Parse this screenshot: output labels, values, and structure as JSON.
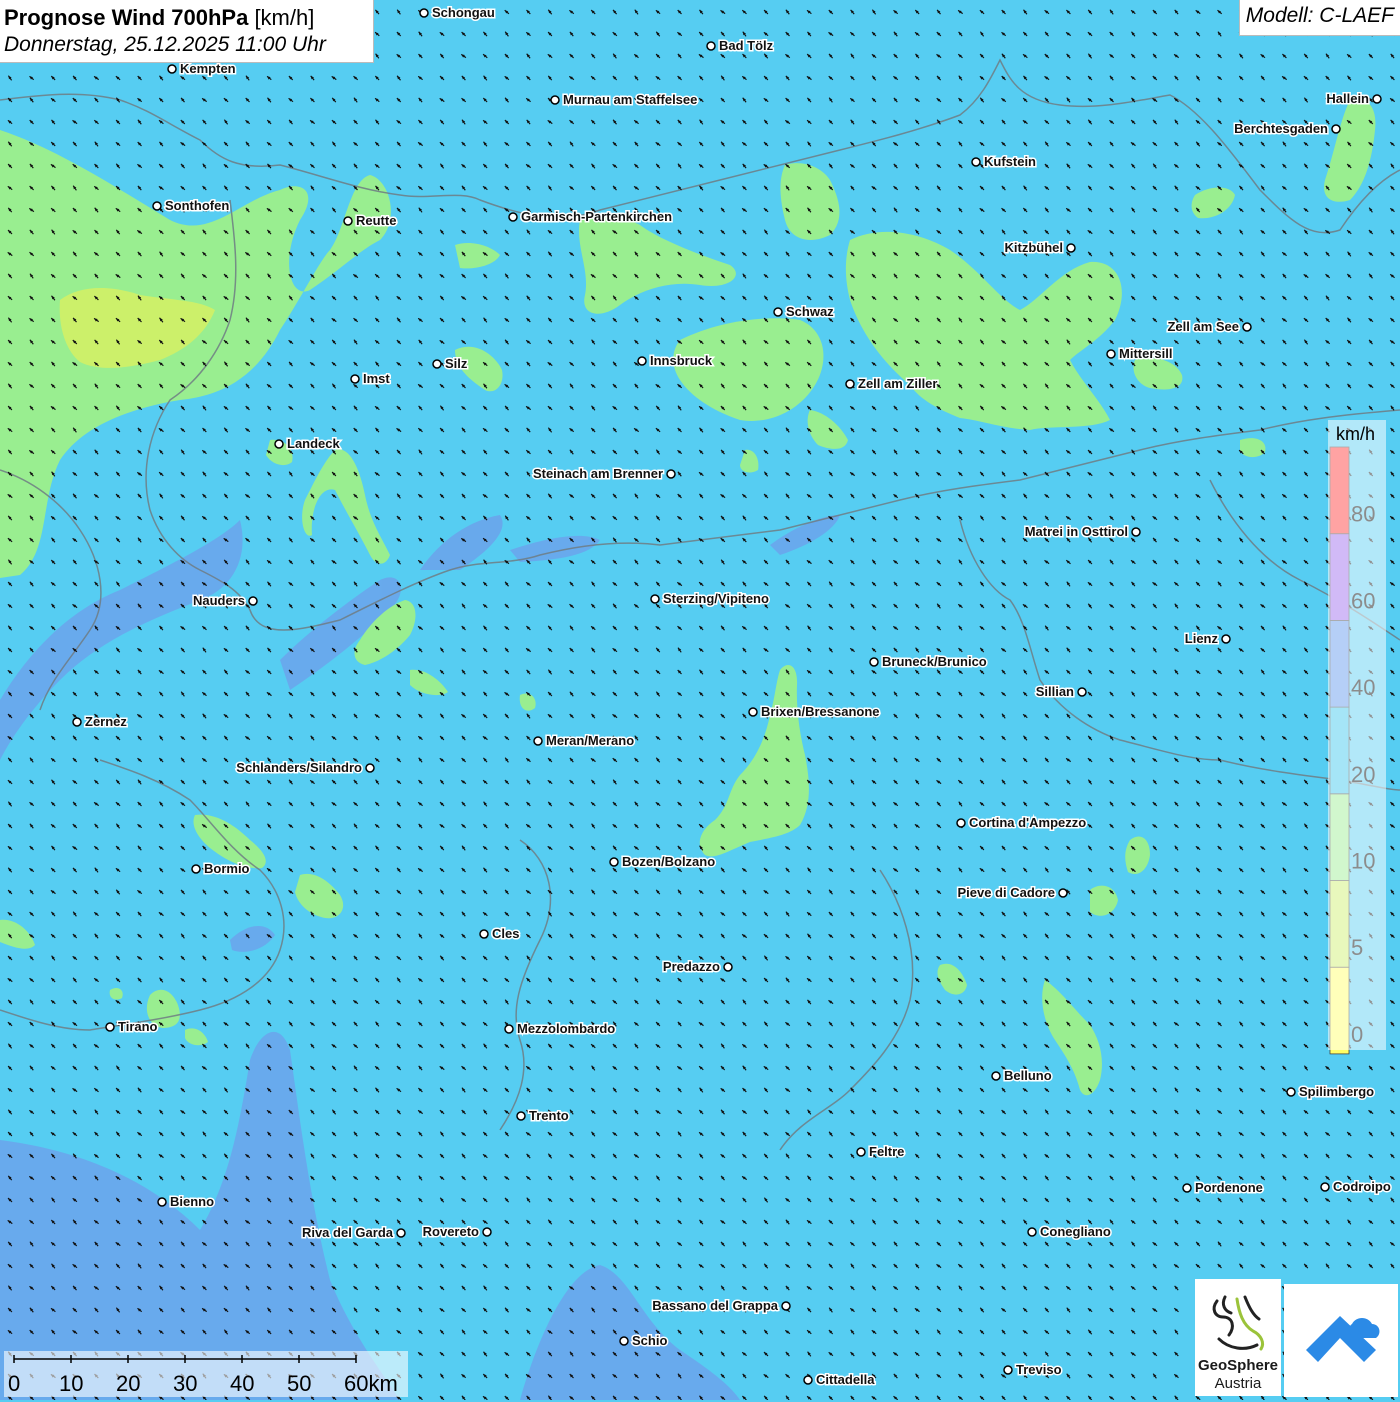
{
  "header": {
    "title_bold": "Prognose Wind 700hPa",
    "title_unit": "[km/h]",
    "datetime": "Donnerstag, 25.12.2025 11:00 Uhr",
    "model": "Modell: C-LAEF"
  },
  "legend": {
    "unit": "km/h",
    "labels": [
      "0",
      "5",
      "10",
      "20",
      "40",
      "60",
      "80"
    ],
    "colors": [
      "#ffff66",
      "#ccf06a",
      "#99ee90",
      "#39c6ee",
      "#5c94ee",
      "#9966ee",
      "#ff3333"
    ]
  },
  "scale": {
    "labels": [
      "0",
      "10",
      "20",
      "30",
      "40",
      "50",
      "60km"
    ]
  },
  "logos": {
    "geosphere_line1": "GeoSphere",
    "geosphere_line2": "Austria"
  },
  "cities": [
    {
      "name": "Schongau"
    },
    {
      "name": "Bad Tölz"
    },
    {
      "name": "Kempten"
    },
    {
      "name": "Murnau am Staffelsee"
    },
    {
      "name": "Hallein"
    },
    {
      "name": "Berchtesgaden"
    },
    {
      "name": "Kufstein"
    },
    {
      "name": "Sonthofen"
    },
    {
      "name": "Reutte"
    },
    {
      "name": "Garmisch-Partenkirchen"
    },
    {
      "name": "Kitzbühel"
    },
    {
      "name": "Zell am See"
    },
    {
      "name": "Schwaz"
    },
    {
      "name": "Mittersill"
    },
    {
      "name": "Silz"
    },
    {
      "name": "Innsbruck"
    },
    {
      "name": "Imst"
    },
    {
      "name": "Zell am Ziller"
    },
    {
      "name": "Landeck"
    },
    {
      "name": "Steinach am Brenner"
    },
    {
      "name": "Matrei in Osttirol"
    },
    {
      "name": "Nauders"
    },
    {
      "name": "Sterzing/Vipiteno"
    },
    {
      "name": "Lienz"
    },
    {
      "name": "Bruneck/Brunico"
    },
    {
      "name": "Sillian"
    },
    {
      "name": "Zernez"
    },
    {
      "name": "Brixen/Bressanone"
    },
    {
      "name": "Meran/Merano"
    },
    {
      "name": "Schlanders/Silandro"
    },
    {
      "name": "Cortina d'Ampezzo"
    },
    {
      "name": "Bozen/Bolzano"
    },
    {
      "name": "Bormio"
    },
    {
      "name": "Pieve di Cadore"
    },
    {
      "name": "Cles"
    },
    {
      "name": "Predazzo"
    },
    {
      "name": "Tirano"
    },
    {
      "name": "Mezzolombardo"
    },
    {
      "name": "Belluno"
    },
    {
      "name": "Spilimbergo"
    },
    {
      "name": "Trento"
    },
    {
      "name": "Feltre"
    },
    {
      "name": "Pordenone"
    },
    {
      "name": "Codroipo"
    },
    {
      "name": "Bienno"
    },
    {
      "name": "Riva del Garda"
    },
    {
      "name": "Rovereto"
    },
    {
      "name": "Conegliano"
    },
    {
      "name": "Bassano del Grappa"
    },
    {
      "name": "Schio"
    },
    {
      "name": "Treviso"
    },
    {
      "name": "Cittadella"
    }
  ]
}
